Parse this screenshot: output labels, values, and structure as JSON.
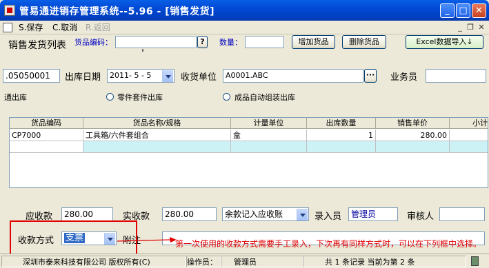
{
  "window": {
    "title": "管易通进销存管理系统--5.96 - [销售发货]"
  },
  "toolbar": {
    "save": "S.保存",
    "cancel": "C.取消",
    "back": "R.返回"
  },
  "form": {
    "list_title": "销售发货列表",
    "product_code_label": "货品编码：",
    "product_code_value": "",
    "lookup_btn": "?",
    "qty_label": "数量：",
    "qty_value": "",
    "add_btn": "增加货品",
    "delete_btn": "删除货品",
    "excel_btn": "Excel数据导入↓",
    "doc_no": ".05050001",
    "ship_date_label": "出库日期",
    "ship_date_value": "2011- 5 - 5",
    "receiver_label": "收货单位",
    "receiver_value": "A0001.ABC",
    "ellipsis_btn": "···",
    "salesman_label": "业务员",
    "salesman_value": "",
    "outbound_type": "通出库",
    "radio_parts": "零件套件出库",
    "radio_assembly": "成品自动组装出库"
  },
  "grid": {
    "headers": [
      "货品编码",
      "货品名称/规格",
      "计量单位",
      "出库数量",
      "销售单价",
      "小计"
    ],
    "rows": [
      [
        "CP7000",
        "工具箱/六件套组合",
        "盒",
        "1",
        "280.00",
        ""
      ]
    ]
  },
  "footer": {
    "receivable_label": "应收款",
    "receivable_value": "280.00",
    "received_label": "实收款",
    "received_value": "280.00",
    "balance_option": "余款记入应收账",
    "entry_person_label": "录入员",
    "entry_person_value": "管理员",
    "reviewer_label": "审核人",
    "reviewer_value": "",
    "payment_method_label": "收款方式",
    "payment_method_value": "支票",
    "note_label": "附注",
    "note_value": ""
  },
  "annotation": "第一次使用的收款方式需要手工录入，下次再有同样方式时，可以在下列框中选择。",
  "statusbar": {
    "company": "深圳市泰来科技有限公司 版权所有(C)",
    "operator_label": "操作员：",
    "operator_value": "管理员",
    "records": "共 1 条记录 当前为第 2 条"
  },
  "colors": {
    "titlebar": "#0149d6",
    "annotation": "#e00000",
    "grid_cyan": "#ccf2f6"
  }
}
